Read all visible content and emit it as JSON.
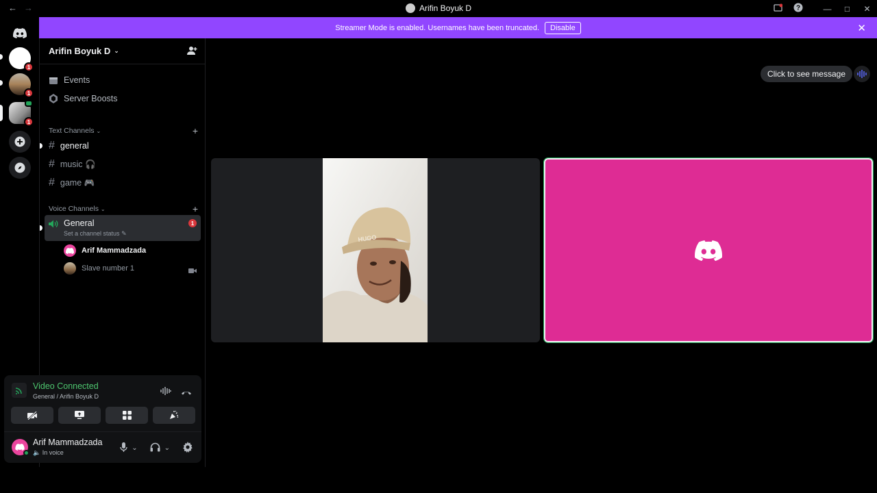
{
  "window": {
    "title": "Arifin Boyuk D",
    "back_arrow": "←",
    "forward_arrow": "→",
    "controls": [
      "minimize",
      "maximize",
      "close"
    ]
  },
  "streamer_bar": {
    "message": "Streamer Mode is enabled. Usernames have been truncated.",
    "disable_label": "Disable",
    "close_glyph": "✕",
    "color": "#9146ff"
  },
  "rail": {
    "servers": [
      {
        "name": "home",
        "badge": "1"
      },
      {
        "name": "server-2",
        "badge": "1"
      },
      {
        "name": "server-3",
        "badge": "1"
      }
    ]
  },
  "server": {
    "name": "Arifin Boyuk D",
    "menu": [
      {
        "label": "Events",
        "icon": "calendar-icon"
      },
      {
        "label": "Server Boosts",
        "icon": "boost-icon"
      }
    ],
    "text_category": "Text Channels",
    "text_channels": [
      {
        "name": "general",
        "emoji": ""
      },
      {
        "name": "music",
        "emoji": "🎧"
      },
      {
        "name": "game",
        "emoji": "🎮"
      }
    ],
    "voice_category": "Voice Channels",
    "voice_channel": {
      "name": "General",
      "status": "Set a channel status",
      "badge": "1",
      "users": [
        {
          "name": "Arif Mammadzada"
        },
        {
          "name": "Slave number 1"
        }
      ]
    }
  },
  "voice_panel": {
    "title": "Video Connected",
    "subtitle": "General / Arifin Boyuk D"
  },
  "user_panel": {
    "name": "Arif Mammadzada",
    "status": "In voice"
  },
  "main": {
    "peek_label": "Click to see message",
    "pink_tile_color": "#de2c94"
  }
}
